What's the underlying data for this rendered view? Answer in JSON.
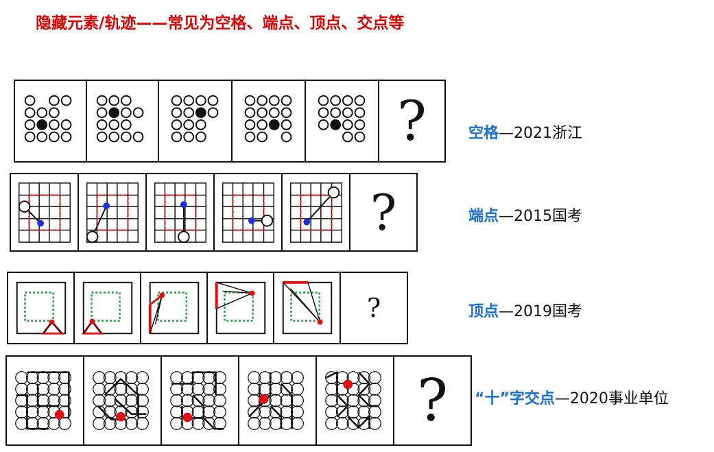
{
  "title": "隐藏元素/轨迹——常见为空格、端点、顶点、交点等",
  "question_mark": "?",
  "rows": [
    {
      "keyword": "空格",
      "source": "—2021浙江"
    },
    {
      "keyword": "端点",
      "source": "—2015国考"
    },
    {
      "keyword": "顶点",
      "source": "—2019国考"
    },
    {
      "keyword": "“十”字交点",
      "source": "—2020事业单位"
    }
  ],
  "colors": {
    "title": "#e00000",
    "keyword": "#1a6fd6",
    "dot_blue": "#1f2fe0",
    "dot_red": "#e01010",
    "dash_red": "#e01010",
    "dot_green": "#1a9a3a"
  }
}
